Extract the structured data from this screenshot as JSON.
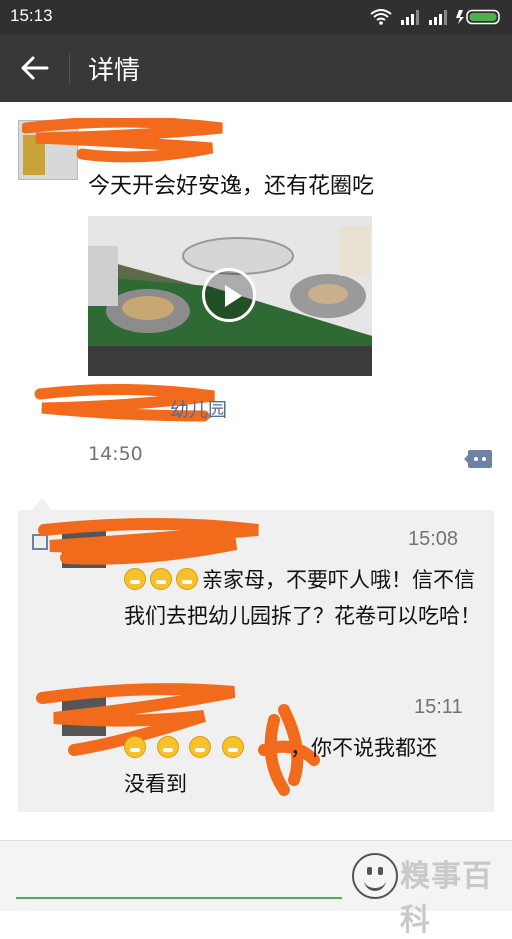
{
  "status_bar": {
    "time": "15:13"
  },
  "header": {
    "title": "详情"
  },
  "post": {
    "text": "今天开会好安逸，还有花圈吃",
    "location": "幼儿园",
    "time": "14:50"
  },
  "comments": [
    {
      "time": "15:08",
      "text": "亲家母，不要吓人哦！信不信我们去把幼儿园拆了？花卷可以吃哈！"
    },
    {
      "time": "15:11",
      "text_line1": "，你不说我都还",
      "text_line2": "没看到"
    }
  ],
  "footer": {
    "watermark": "糗事百科"
  },
  "colors": {
    "accent": "#4caf50",
    "link": "#4e6d97",
    "redact": "#f26a1b"
  },
  "icons": [
    "back-arrow-icon",
    "wifi-icon",
    "signal-icon",
    "battery-icon",
    "play-icon",
    "comment-icon",
    "like-icon",
    "smiley-icon"
  ]
}
